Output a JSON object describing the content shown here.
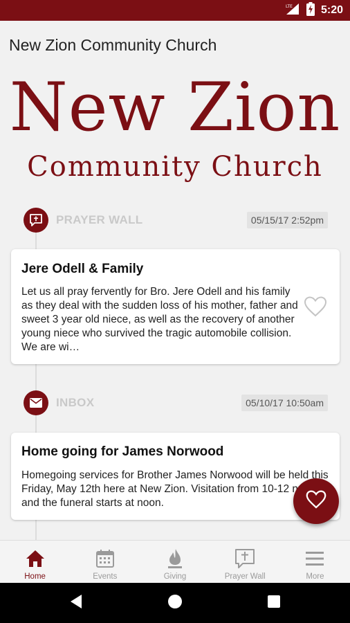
{
  "status_bar": {
    "time": "5:20",
    "network_label": "LTE"
  },
  "app_bar": {
    "title": "New Zion Community Church"
  },
  "logo": {
    "line1": "New Zion",
    "line2": "Community Church"
  },
  "feed": [
    {
      "section": "PRAYER WALL",
      "timestamp": "05/15/17 2:52pm",
      "icon": "prayer-wall-icon",
      "card_title": "Jere Odell & Family",
      "card_body": "Let us all pray fervently for Bro. Jere Odell and his family as they deal with the sudden loss of his mother, father and sweet 3 year old niece, as well as the recovery of another young niece who survived the tragic automobile collision. We are wi…"
    },
    {
      "section": "INBOX",
      "timestamp": "05/10/17 10:50am",
      "icon": "mail-icon",
      "card_title": "Home going for James Norwood",
      "card_body": "Homegoing services for  Brother James Norwood will be held this Friday, May 12th here at New Zion.  Visitation from 10-12 noon and the funeral starts at noon."
    }
  ],
  "bottom_nav": {
    "items": [
      {
        "label": "Home",
        "icon": "home-icon",
        "active": true
      },
      {
        "label": "Events",
        "icon": "calendar-icon",
        "active": false
      },
      {
        "label": "Giving",
        "icon": "flame-icon",
        "active": false
      },
      {
        "label": "Prayer Wall",
        "icon": "prayer-wall-icon",
        "active": false
      },
      {
        "label": "More",
        "icon": "menu-icon",
        "active": false
      }
    ]
  },
  "colors": {
    "brand": "#7b0f14",
    "inactive": "#9a9a9a",
    "background": "#f1f1f1"
  }
}
